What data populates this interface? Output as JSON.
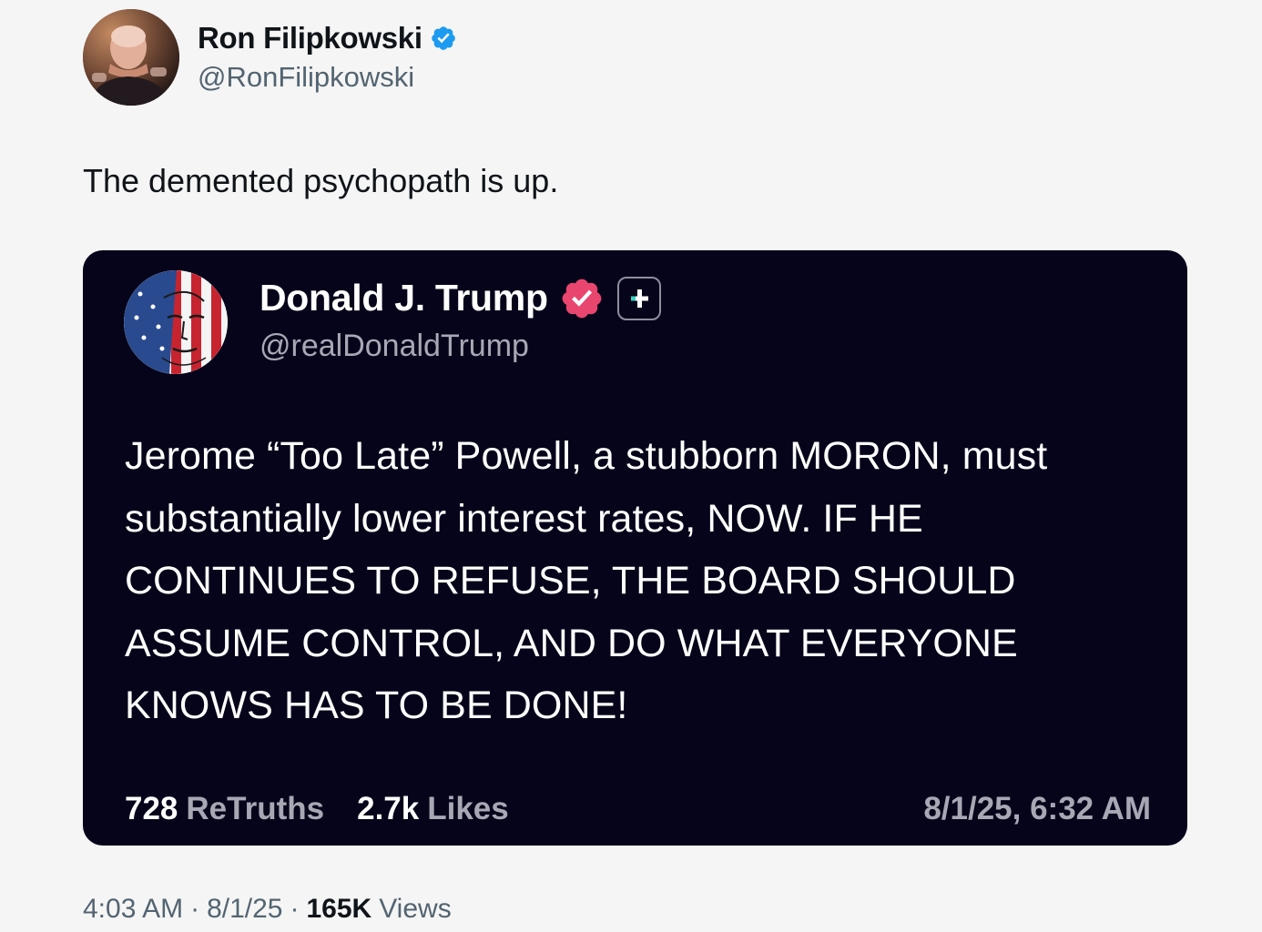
{
  "author": {
    "name": "Ron Filipkowski",
    "handle": "@RonFilipkowski",
    "verified_color": "#1d9bf0"
  },
  "tweet": {
    "text": "The demented psychopath is up."
  },
  "quoted_post": {
    "name": "Donald J. Trump",
    "handle": "@realDonaldTrump",
    "verified_color": "#e9466f",
    "badge_icon": "plus-icon",
    "body": "Jerome “Too Late” Powell, a stubborn MORON, must substantially lower interest rates, NOW. IF HE CONTINUES TO REFUSE, THE BOARD SHOULD ASSUME CONTROL, AND DO WHAT EVERYONE KNOWS HAS TO BE DONE!",
    "retruths_count": "728",
    "retruths_label": "ReTruths",
    "likes_count": "2.7k",
    "likes_label": "Likes",
    "timestamp": "8/1/25, 6:32 AM",
    "background_color": "#05041a"
  },
  "meta": {
    "time": "4:03 AM",
    "date": "8/1/25",
    "separator": "·",
    "views_count": "165K",
    "views_label": "Views"
  }
}
